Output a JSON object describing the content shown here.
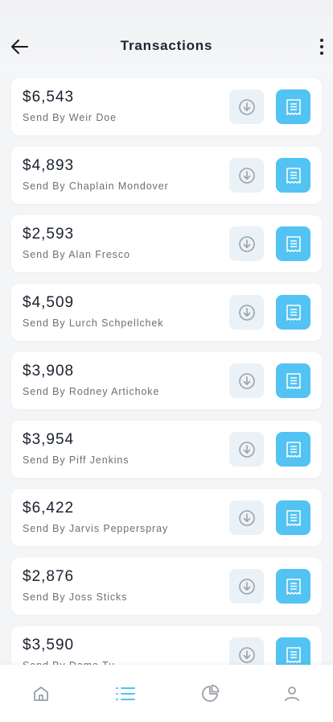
{
  "header": {
    "title": "Transactions",
    "back_icon": "arrow-left-icon",
    "more_icon": "more-vertical-icon"
  },
  "colors": {
    "accent": "#52c3f2",
    "download_bg": "#eaf2f7",
    "download_icon": "#9aa3aa",
    "nav_active": "#52c3f2",
    "nav_inactive": "#9aa0a6"
  },
  "transactions": [
    {
      "amount": "$6,543",
      "sender": "Send By Weir Doe"
    },
    {
      "amount": "$4,893",
      "sender": "Send By Chaplain Mondover"
    },
    {
      "amount": "$2,593",
      "sender": "Send By Alan Fresco"
    },
    {
      "amount": "$4,509",
      "sender": "Send By Lurch Schpellchek"
    },
    {
      "amount": "$3,908",
      "sender": "Send By Rodney Artichoke"
    },
    {
      "amount": "$3,954",
      "sender": "Send By Piff Jenkins"
    },
    {
      "amount": "$6,422",
      "sender": "Send By Jarvis Pepperspray"
    },
    {
      "amount": "$2,876",
      "sender": "Send By Joss Sticks"
    },
    {
      "amount": "$3,590",
      "sender": "Send By Dame Tu"
    }
  ],
  "row_actions": {
    "download_icon": "download-circle-icon",
    "receipt_icon": "receipt-icon"
  },
  "bottom_nav": [
    {
      "icon": "home-icon",
      "active": false
    },
    {
      "icon": "list-icon",
      "active": true
    },
    {
      "icon": "pie-chart-icon",
      "active": false
    },
    {
      "icon": "user-icon",
      "active": false
    }
  ]
}
